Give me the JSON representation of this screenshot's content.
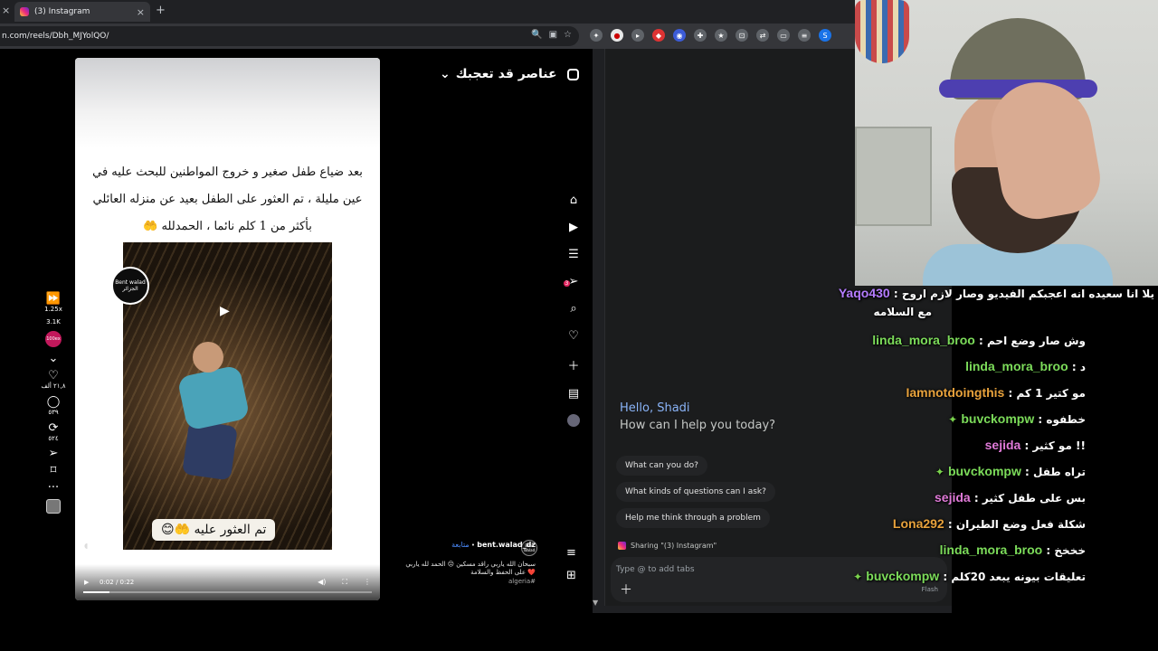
{
  "browser": {
    "tab_title": "(3) Instagram",
    "tab_close": "×",
    "new_tab": "+",
    "url": "n.com/reels/Dbh_MJYolQO/",
    "extensions": [
      "S"
    ]
  },
  "instagram": {
    "suggest_header": "عناصر قد تعجبك",
    "caption": "بعد ضياع طفل صغير و خروج المواطنين للبحث عليه في عين مليلة ، تم العثور على الطفل بعيد عن منزله العائلي بأكثر من 1 كلم نائما ، الحمدلله 🤲",
    "watermark_line1": "Bent walad",
    "watermark_line2": "الجزائر",
    "found_label": "تم العثور عليه 🤲😊",
    "video_time": "0:02 / 0:22",
    "progress": 0.09,
    "rail": {
      "speed": "1.25x",
      "views": "3.1K",
      "badge": "100ex",
      "likes": "٢١,٨ ألف",
      "comments": "٥٣٩",
      "shares": "٥٢٤"
    },
    "author": {
      "name": "bent.walad_dz",
      "follow": "متابعة",
      "avatar_text": "Bent Walad",
      "desc": "سبحان الله ياربي راقد مسكين 😔 الحمد لله ياربي ❤️ على الحفظ والسلامة",
      "hashtag": "#algeria"
    },
    "nav_badge": "3"
  },
  "gemini": {
    "hello": "Hello, Shadi",
    "question": "How can I help you today?",
    "chips": [
      "What can you do?",
      "What kinds of questions can I ask?",
      "Help me think through a problem"
    ],
    "sharing": "Sharing \"(3) Instagram\"",
    "placeholder": "Type @ to add tabs",
    "model": "Flash"
  },
  "chat": [
    {
      "user": "Yaqo430",
      "color": "#b57cff",
      "text": "يلا انا سعيده انه اعجبكم الفيديو وصار لازم اروح",
      "cont": "مع السلامه",
      "gem": false
    },
    {
      "user": "linda_mora_broo",
      "color": "#7cdc5a",
      "text": "وش صار وضع احم",
      "gem": false
    },
    {
      "user": "linda_mora_broo",
      "color": "#7cdc5a",
      "text": "د",
      "gem": false
    },
    {
      "user": "Iamnotdoingthis",
      "color": "#e8a23c",
      "text": "مو كتير 1 كم",
      "gem": false
    },
    {
      "user": "buvckompw",
      "color": "#7cdc5a",
      "text": "خطفوه",
      "gem": true
    },
    {
      "user": "sejida",
      "color": "#e07ad8",
      "text": "!! مو كثير",
      "gem": false
    },
    {
      "user": "buvckompw",
      "color": "#7cdc5a",
      "text": "تراه طفل",
      "gem": true
    },
    {
      "user": "sejida",
      "color": "#e07ad8",
      "text": "بس على طفل كثير",
      "gem": false
    },
    {
      "user": "Lona292",
      "color": "#e8a23c",
      "text": "شكلة فعل وضع الطيران",
      "gem": false
    },
    {
      "user": "linda_mora_broo",
      "color": "#7cdc5a",
      "text": "خخخخ",
      "gem": false
    },
    {
      "user": "buvckompw",
      "color": "#7cdc5a",
      "text": "تعليقات بيونه يبعد 20كلم",
      "gem": true
    }
  ]
}
